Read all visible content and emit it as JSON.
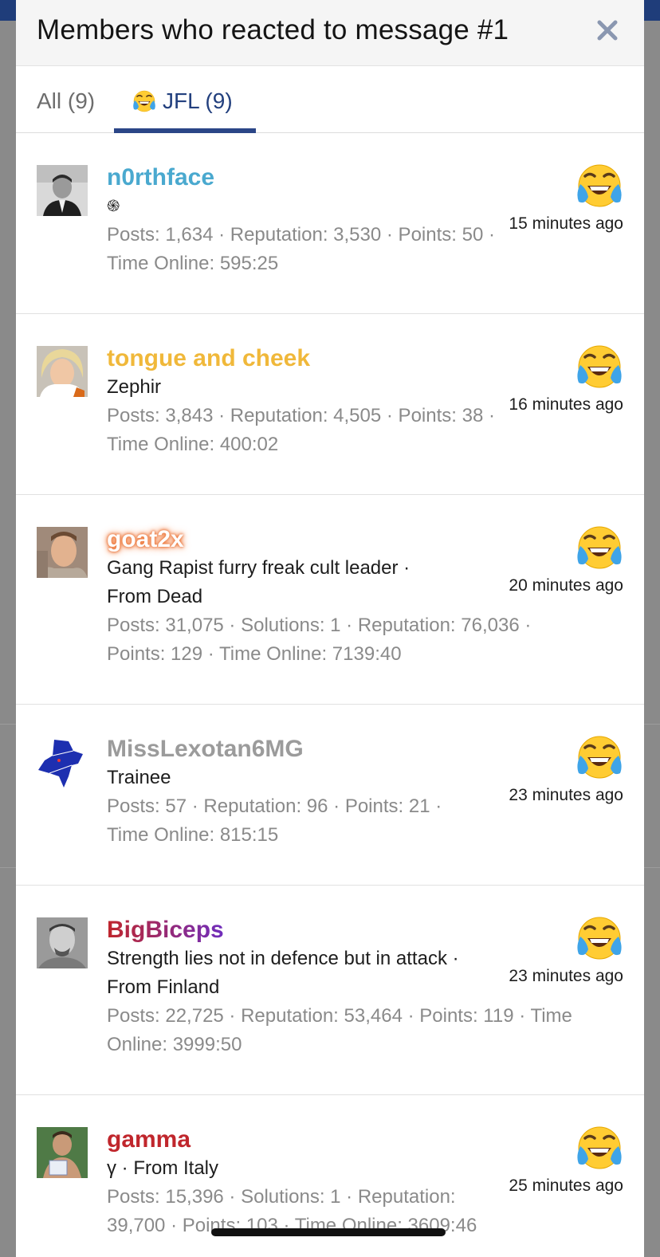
{
  "modal": {
    "title": "Members who reacted to message #1",
    "close_label": "×"
  },
  "tabs": [
    {
      "label": "All (9)",
      "active": false
    },
    {
      "label": "JFL (9)",
      "active": true,
      "icon": "crying-laughing-emoji-icon"
    }
  ],
  "colors": {
    "accent": "#2b4687",
    "n0rthface": "#4aa9cf",
    "tongue": "#f0b83a",
    "goat": "#ffffff",
    "miss": "#9b9b9b",
    "bigbiceps_start": "#c0262c",
    "bigbiceps_end": "#6f2dbd",
    "gamma": "#c0262c"
  },
  "members": [
    {
      "name": "n0rthface",
      "title": "֍",
      "stats": "Posts: 1,634 · Reputation: 3,530 · Points: 50 · Time Online: 595:25",
      "time": "15 minutes ago",
      "reaction": "crying-laughing-emoji-icon"
    },
    {
      "name": "tongue and cheek",
      "title": "Zephir",
      "stats": "Posts: 3,843 · Reputation: 4,505 · Points: 38 · Time Online: 400:02",
      "time": "16 minutes ago",
      "reaction": "crying-laughing-emoji-icon"
    },
    {
      "name": "goat2x",
      "title": "Gang Rapist furry freak cult leader · From Dead",
      "stats": "Posts: 31,075 · Solutions: 1 · Reputation: 76,036 · Points: 129 · Time Online: 7139:40",
      "time": "20 minutes ago",
      "reaction": "crying-laughing-emoji-icon"
    },
    {
      "name": "MissLexotan6MG",
      "title": "Trainee",
      "stats": "Posts: 57 · Reputation: 96 · Points: 21 · Time Online: 815:15",
      "time": "23 minutes ago",
      "reaction": "crying-laughing-emoji-icon"
    },
    {
      "name": "BigBiceps",
      "title": "Strength lies not in defence but in attack · From Finland",
      "stats": "Posts: 22,725 · Reputation: 53,464 · Points: 119 · Time Online: 3999:50",
      "time": "23 minutes ago",
      "reaction": "crying-laughing-emoji-icon"
    },
    {
      "name": "gamma",
      "title": "γ · From Italy",
      "stats": "Posts: 15,396 · Solutions: 1 · Reputation: 39,700 · Points: 103 · Time Online: 3609:46",
      "time": "25 minutes ago",
      "reaction": "crying-laughing-emoji-icon"
    }
  ]
}
